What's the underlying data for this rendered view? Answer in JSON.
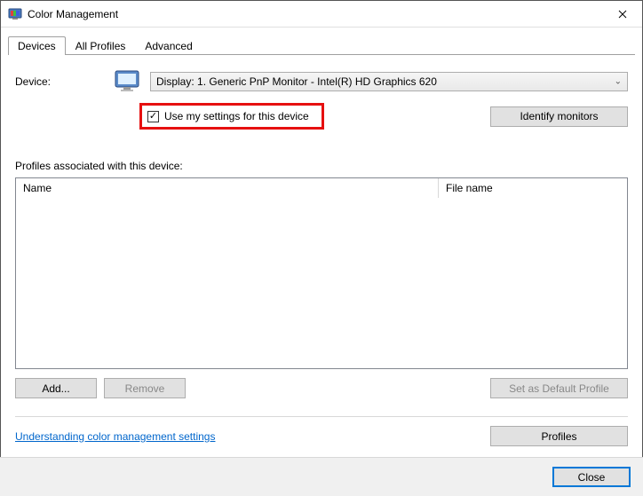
{
  "window": {
    "title": "Color Management"
  },
  "tabs": {
    "devices": "Devices",
    "all_profiles": "All Profiles",
    "advanced": "Advanced"
  },
  "device": {
    "label": "Device:",
    "selected": "Display: 1. Generic PnP Monitor - Intel(R) HD Graphics 620",
    "use_my_settings": "Use my settings for this device",
    "use_my_settings_checked": true,
    "identify_button": "Identify monitors"
  },
  "profiles": {
    "heading": "Profiles associated with this device:",
    "col_name": "Name",
    "col_filename": "File name",
    "add": "Add...",
    "remove": "Remove",
    "set_default": "Set as Default Profile"
  },
  "footer": {
    "help_link": "Understanding color management settings",
    "profiles_button": "Profiles"
  },
  "dialog": {
    "close": "Close"
  }
}
